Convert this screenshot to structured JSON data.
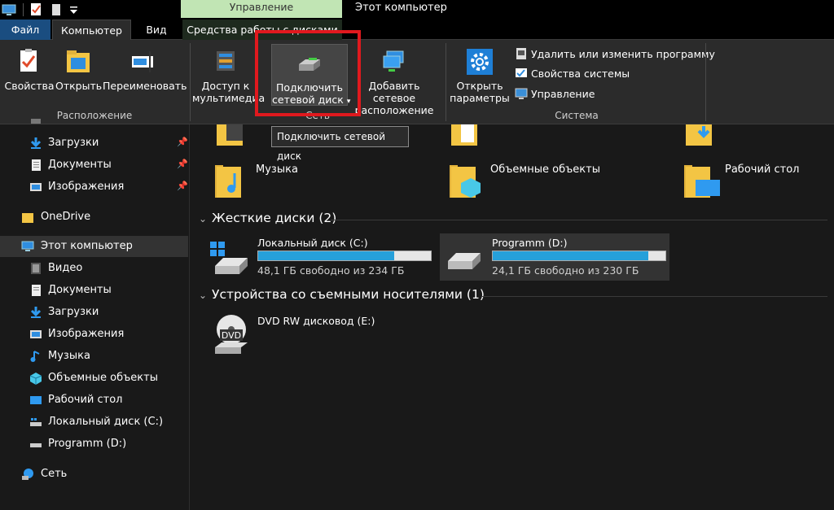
{
  "titlebar": {
    "context_group": "Управление",
    "window_title": "Этот компьютер"
  },
  "tabs": {
    "file": "Файл",
    "computer": "Компьютер",
    "view": "Вид",
    "disk_tools": "Средства работы с дисками"
  },
  "ribbon": {
    "location": {
      "label": "Расположение",
      "properties": "Свойства",
      "open": "Открыть",
      "rename": "Переименовать"
    },
    "network": {
      "label": "Сеть",
      "media_access": [
        "Доступ к",
        "мультимедиа"
      ],
      "map_drive": [
        "Подключить",
        "сетевой диск"
      ],
      "add_location": [
        "Добавить сетевое",
        "расположение"
      ]
    },
    "system": {
      "label": "Система",
      "open_settings": [
        "Открыть",
        "параметры"
      ],
      "uninstall": "Удалить или изменить программу",
      "system_properties": "Свойства системы",
      "manage": "Управление"
    }
  },
  "tooltip": "Подключить сетевой диск",
  "nav": {
    "items": [
      {
        "label": "Загрузки",
        "icon": "download-icon",
        "pinned": true
      },
      {
        "label": "Документы",
        "icon": "document-icon",
        "pinned": true
      },
      {
        "label": "Изображения",
        "icon": "pictures-icon",
        "pinned": true
      },
      {
        "label": "OneDrive",
        "icon": "onedrive-folder-icon"
      },
      {
        "label": "Этот компьютер",
        "icon": "this-pc-icon",
        "selected": true
      },
      {
        "label": "Видео",
        "icon": "video-icon"
      },
      {
        "label": "Документы",
        "icon": "document-icon"
      },
      {
        "label": "Загрузки",
        "icon": "download-icon"
      },
      {
        "label": "Изображения",
        "icon": "pictures-icon"
      },
      {
        "label": "Музыка",
        "icon": "music-icon"
      },
      {
        "label": "Объемные объекты",
        "icon": "3d-objects-icon"
      },
      {
        "label": "Рабочий стол",
        "icon": "desktop-icon"
      },
      {
        "label": "Локальный диск (C:)",
        "icon": "drive-c-icon"
      },
      {
        "label": "Programm (D:)",
        "icon": "drive-icon"
      },
      {
        "label": "Сеть",
        "icon": "network-icon"
      }
    ]
  },
  "folders": [
    {
      "label": "Музыка",
      "icon": "music-folder-icon"
    },
    {
      "label": "Объемные объекты",
      "icon": "3d-objects-folder-icon"
    },
    {
      "label": "Рабочий стол",
      "icon": "desktop-folder-icon"
    }
  ],
  "sections": {
    "hard_drives": "Жесткие диски (2)",
    "removable": "Устройства со съемными носителями (1)"
  },
  "drives": [
    {
      "name": "Локальный диск (C:)",
      "free_text": "48,1 ГБ свободно из 234 ГБ",
      "used_fraction": 0.79
    },
    {
      "name": "Programm (D:)",
      "free_text": "24,1 ГБ свободно из 230 ГБ",
      "used_fraction": 0.9
    }
  ],
  "removable_drive": {
    "name": "DVD RW дисковод (E:)",
    "badge": "DVD"
  },
  "colors": {
    "accent": "#26a0da",
    "manage_band": "#c1e5b4",
    "highlight_box": "#e0191e",
    "file_tab": "#1a4d80"
  }
}
